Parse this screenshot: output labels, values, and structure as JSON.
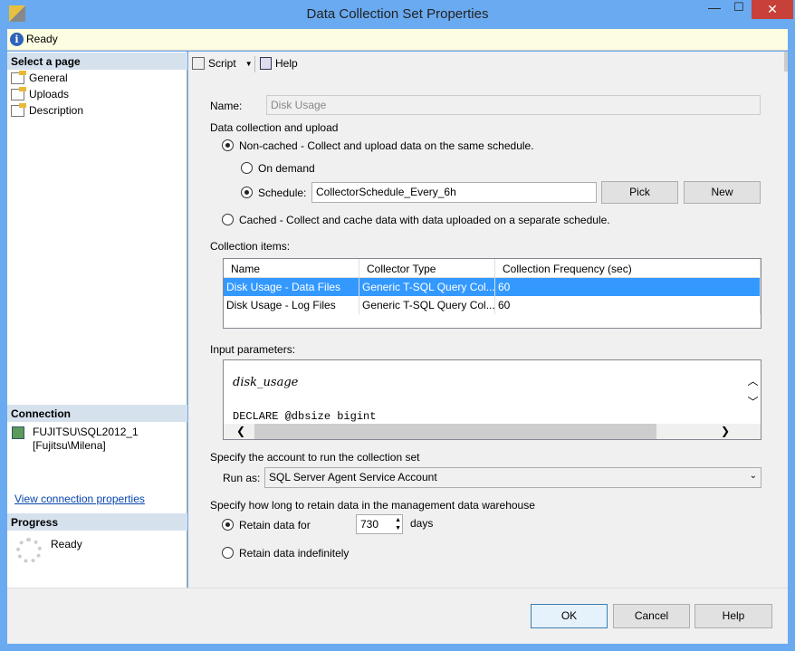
{
  "window": {
    "title": "Data Collection Set Properties",
    "minimize": "—",
    "maximize": "☐",
    "close": "✕"
  },
  "status": {
    "text": "Ready"
  },
  "sidebar": {
    "select_header": "Select a page",
    "items": [
      {
        "label": "General"
      },
      {
        "label": "Uploads"
      },
      {
        "label": "Description"
      }
    ],
    "connection_header": "Connection",
    "server": "FUJITSU\\SQL2012_1",
    "user": "[Fujitsu\\Milena]",
    "view_link": "View connection properties",
    "progress_header": "Progress",
    "progress_status": "Ready"
  },
  "toolbar": {
    "script": "Script",
    "help": "Help"
  },
  "form": {
    "name_label": "Name:",
    "name_value": "Disk Usage",
    "data_collection_label": "Data collection and upload",
    "non_cached": "Non-cached - Collect and upload data on the same schedule.",
    "on_demand": "On demand",
    "schedule": "Schedule:",
    "schedule_value": "CollectorSchedule_Every_6h",
    "pick": "Pick",
    "new": "New",
    "cached": "Cached - Collect and cache data with data uploaded on a separate schedule.",
    "collection_items_label": "Collection items:",
    "columns": [
      "Name",
      "Collector Type",
      "Collection Frequency (sec)"
    ],
    "rows": [
      [
        "Disk Usage - Data Files",
        "Generic T-SQL Query Col...",
        "60"
      ],
      [
        "Disk Usage - Log Files",
        "Generic T-SQL Query Col...",
        "60"
      ]
    ],
    "input_params_label": "Input parameters:",
    "param_title": "disk_usage",
    "param_code": "DECLARE @dbsize bigint",
    "account_label": "Specify the account to run the collection set",
    "run_as_label": "Run as:",
    "run_as_value": "SQL Server Agent Service Account",
    "retain_label": "Specify how long to retain data in the management data warehouse",
    "retain_for": "Retain data for",
    "retain_days": "730",
    "days": "days",
    "retain_indef": "Retain data indefinitely"
  },
  "buttons": {
    "ok": "OK",
    "cancel": "Cancel",
    "help": "Help"
  }
}
